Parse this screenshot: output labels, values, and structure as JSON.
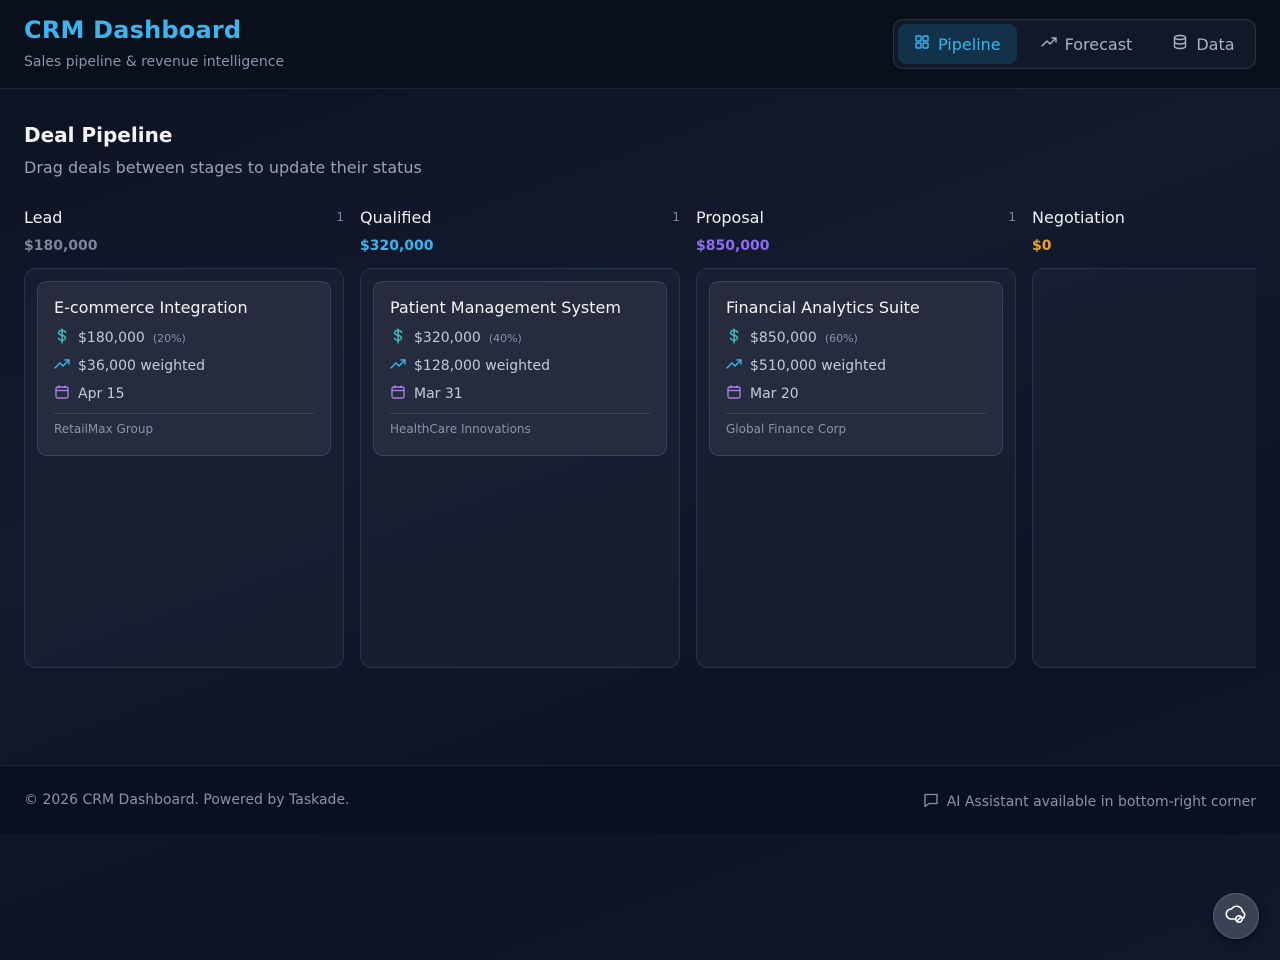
{
  "header": {
    "title": "CRM Dashboard",
    "subtitle": "Sales pipeline & revenue intelligence",
    "tabs": [
      {
        "label": "Pipeline",
        "icon": "grid-icon",
        "active": true
      },
      {
        "label": "Forecast",
        "icon": "trending-up-icon",
        "active": false
      },
      {
        "label": "Data",
        "icon": "database-icon",
        "active": false
      }
    ]
  },
  "main": {
    "title": "Deal Pipeline",
    "subtitle": "Drag deals between stages to update their status",
    "columns": [
      {
        "name": "Lead",
        "count": "1",
        "total": "$180,000",
        "color": "#7d8598",
        "deal": {
          "title": "E-commerce Integration",
          "value": "$180,000",
          "probability": "(20%)",
          "weighted": "$36,000 weighted",
          "date": "Apr 15",
          "client": "RetailMax Group"
        }
      },
      {
        "name": "Qualified",
        "count": "1",
        "total": "$320,000",
        "color": "#38b6f0",
        "deal": {
          "title": "Patient Management System",
          "value": "$320,000",
          "probability": "(40%)",
          "weighted": "$128,000 weighted",
          "date": "Mar 31",
          "client": "HealthCare Innovations"
        }
      },
      {
        "name": "Proposal",
        "count": "1",
        "total": "$850,000",
        "color": "#8b6ff0",
        "deal": {
          "title": "Financial Analytics Suite",
          "value": "$850,000",
          "probability": "(60%)",
          "weighted": "$510,000 weighted",
          "date": "Mar 20",
          "client": "Global Finance Corp"
        }
      },
      {
        "name": "Negotiation",
        "count": "",
        "total": "$0",
        "color": "#f0a020"
      }
    ]
  },
  "footer": {
    "copyright": "© 2026 CRM Dashboard. Powered by Taskade.",
    "assistant": "AI Assistant available in bottom-right corner"
  },
  "colors": {
    "accent": "#38b6f0",
    "value_icon": "#3cc6c0",
    "weighted_icon": "#38b6f0",
    "date_icon": "#a87ee8"
  }
}
